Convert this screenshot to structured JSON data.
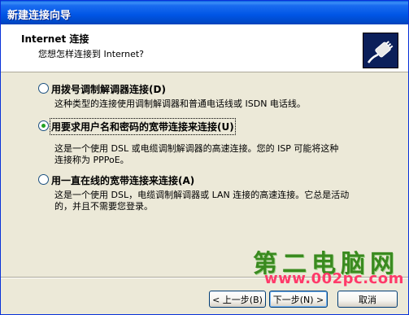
{
  "window": {
    "title": "新建连接向导"
  },
  "header": {
    "title": "Internet 连接",
    "subtitle": "您想怎样连接到 Internet?",
    "icon": "network-plug-icon"
  },
  "options": [
    {
      "label": "用拨号调制解调器连接(D)",
      "checked": false,
      "desc_lines": [
        "这种类型的连接使用调制解调器和普通电话线或 ISDN 电话线。"
      ]
    },
    {
      "label": "用要求用户名和密码的宽带连接来连接(U)",
      "checked": true,
      "desc_lines": [
        "这是一个使用 DSL 或电缆调制解调器的高速连接。您的 ISP 可能将这种",
        "连接称为 PPPoE。"
      ]
    },
    {
      "label": "用一直在线的宽带连接来连接(A)",
      "checked": false,
      "desc_lines": [
        "这是一个使用 DSL，电缆调制解调器或 LAN 连接的高速连接。它总是活动",
        "的，并且不需要您登录。"
      ]
    }
  ],
  "buttons": {
    "back": "< 上一步(B)",
    "next": "下一步(N) >",
    "cancel": "取消"
  },
  "watermark": {
    "text": "第二电脑网",
    "url": "www.002pc.com"
  }
}
